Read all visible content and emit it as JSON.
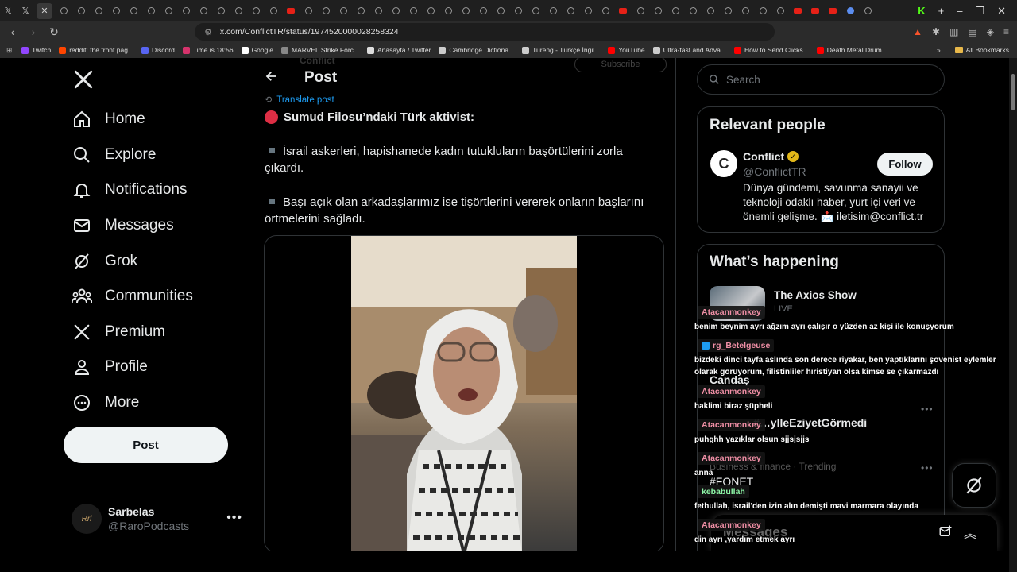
{
  "browser": {
    "url": "x.com/ConflictTR/status/1974520000028258324",
    "all_bookmarks": "All Bookmarks",
    "bookmarks": [
      {
        "label": "Twitch",
        "color": "#9146ff"
      },
      {
        "label": "reddit: the front pag...",
        "color": "#ff4500"
      },
      {
        "label": "Discord",
        "color": "#5865f2"
      },
      {
        "label": "Time.is 18:56",
        "color": "#d6336c"
      },
      {
        "label": "Google",
        "color": "#ffffff"
      },
      {
        "label": "MARVEL Strike Forc...",
        "color": "#888888"
      },
      {
        "label": "Anasayfa / Twitter",
        "color": "#dddddd"
      },
      {
        "label": "Cambridge Dictiona...",
        "color": "#cccccc"
      },
      {
        "label": "Tureng - Türkçe İngil...",
        "color": "#cccccc"
      },
      {
        "label": "YouTube",
        "color": "#ff0000"
      },
      {
        "label": "Ultra-fast and Adva...",
        "color": "#cccccc"
      },
      {
        "label": "How to Send Clicks...",
        "color": "#ff0000"
      },
      {
        "label": "Death Metal Drum...",
        "color": "#ff0000"
      }
    ]
  },
  "nav": {
    "items": [
      {
        "label": "Home"
      },
      {
        "label": "Explore"
      },
      {
        "label": "Notifications"
      },
      {
        "label": "Messages"
      },
      {
        "label": "Grok"
      },
      {
        "label": "Communities"
      },
      {
        "label": "Premium"
      },
      {
        "label": "Profile"
      },
      {
        "label": "More"
      }
    ],
    "post_button": "Post",
    "account": {
      "name": "Sarbelas",
      "handle": "@RaroPodcasts",
      "avatar_text": "Rrl"
    }
  },
  "main": {
    "header_title": "Post",
    "ghost_name": "Conflict",
    "ghost_subscribe": "Subscribe",
    "translate": "Translate post",
    "headline": "Sumud Filosu’ndaki Türk aktivist:",
    "para1": "İsrail askerleri, hapishanede kadın tutukluların başörtülerini zorla çıkardı.",
    "para2": "Başı açık olan arkadaşlarımız ise tişörtlerini vererek onların başlarını örtmelerini sağladı."
  },
  "right": {
    "search_placeholder": "Search",
    "relevant": {
      "title": "Relevant people",
      "name": "Conflict",
      "handle": "@ConflictTR",
      "follow": "Follow",
      "bio": "Dünya gündemi, savunma sanayii ve teknoloji odaklı haber, yurt içi veri ve önemli gelişme. 📩 iletisim@conflict.tr"
    },
    "happening": {
      "title": "What’s happening",
      "trend_title": "The Axios Show",
      "trend_live": "LIVE",
      "ghost1": "Candaş",
      "ghost2": "#…ylleEziyetGörmedi",
      "ghost3": "Business & finance · Trending",
      "ghost4": "#FONET"
    },
    "messages_drawer": "Messages"
  },
  "chat": [
    {
      "user": "Atacanmonkey",
      "msg": "benim beynim ayrı ağzım ayrı çalışır o yüzden az kişi ile konuşyorum",
      "color": "#f08fa6"
    },
    {
      "user": "rg_Betelgeuse",
      "msg": "bizdeki dinci tayfa aslında son derece riyakar, ben yaptıklarını şovenist eylemler olarak görüyorum, filistinliler hıristiyan olsa kimse se çıkarmazdı",
      "color": "#f08fa6"
    },
    {
      "user": "Atacanmonkey",
      "msg": "haklimi biraz şüpheli",
      "color": "#f08fa6"
    },
    {
      "user": "Atacanmonkey",
      "msg": "puhghh yazıklar olsun sjjsjsjjs",
      "color": "#f08fa6"
    },
    {
      "user": "Atacanmonkey",
      "msg": "anna",
      "color": "#f08fa6"
    },
    {
      "user": "kebabullah",
      "msg": "fethullah, israil'den izin alın demişti mavi marmara olayında",
      "color": "#8df5a6"
    },
    {
      "user": "Atacanmonkey",
      "msg": "din ayrı ,yardım etmek ayrı",
      "color": "#f08fa6"
    }
  ]
}
